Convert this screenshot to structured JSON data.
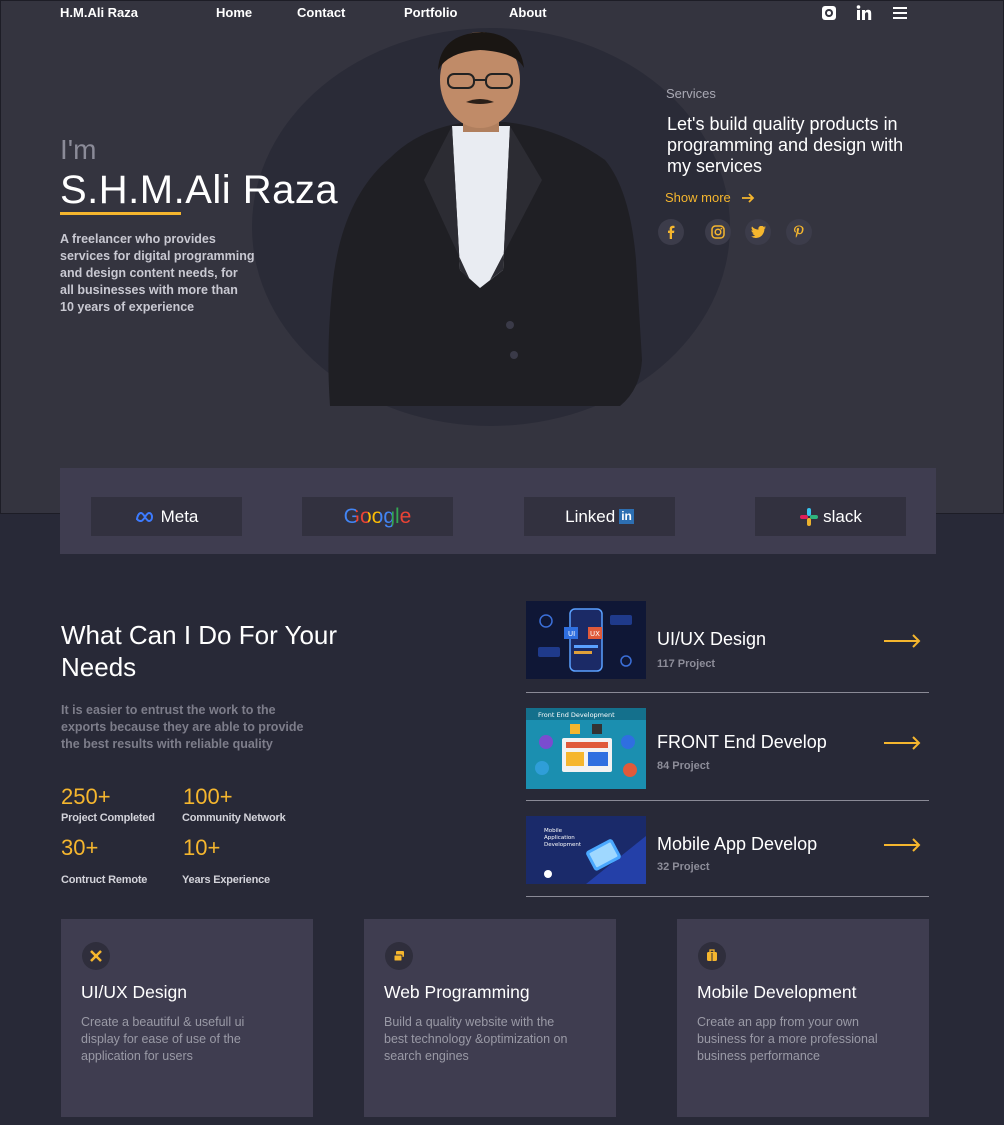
{
  "nav": {
    "brand": "H.M.Ali Raza",
    "links": [
      "Home",
      "Contact",
      "Portfolio",
      "About"
    ],
    "icons": [
      "github-icon",
      "linkedin-icon",
      "menu-icon"
    ]
  },
  "hero": {
    "greeting": "I'm",
    "name": "S.H.M.Ali Raza",
    "description": "A freelancer who provides services for digital programming and design content needs, for all businesses with more than 10 years of experience",
    "services_label": "Services",
    "services_title": "Let's build quality products in programming and design with my services",
    "show_more": "Show more",
    "socials": [
      "facebook-icon",
      "instagram-icon",
      "twitter-icon",
      "pinterest-icon"
    ]
  },
  "brands": [
    "Meta",
    "Google",
    "Linked",
    "in",
    "slack"
  ],
  "what": {
    "title": "What Can I Do For Your Needs",
    "description": "It is easier to entrust the work to the exports because they are able to provide the best results with reliable quality",
    "stats": [
      {
        "value": "250+",
        "label": "Project Completed"
      },
      {
        "value": "100+",
        "label": "Community Network"
      },
      {
        "value": "30+",
        "label": "Contruct Remote"
      },
      {
        "value": "10+",
        "label": "Years Experience"
      }
    ]
  },
  "service_list": [
    {
      "title": "UI/UX Design",
      "count": "117 Project",
      "thumb_text": ""
    },
    {
      "title": "FRONT End Develop",
      "count": "84 Project",
      "thumb_text": "Front End Development"
    },
    {
      "title": "Mobile App Develop",
      "count": "32 Project",
      "thumb_text": "Mobile Application Development"
    }
  ],
  "cards": [
    {
      "title": "UI/UX Design",
      "description": "Create a beautiful & usefull ui display for ease of use of the application for users",
      "icon": "design-tools-icon"
    },
    {
      "title": "Web Programming",
      "description": "Build a quality website with the best technology &optimization on search engines",
      "icon": "code-icon"
    },
    {
      "title": "Mobile Development",
      "description": "Create an app from your own business for a more professional business performance",
      "icon": "mobile-app-icon"
    }
  ],
  "colors": {
    "accent": "#f5b62e",
    "hero_bg": "#34343f",
    "page_bg": "#282937",
    "card_bg": "#3f3d50"
  }
}
